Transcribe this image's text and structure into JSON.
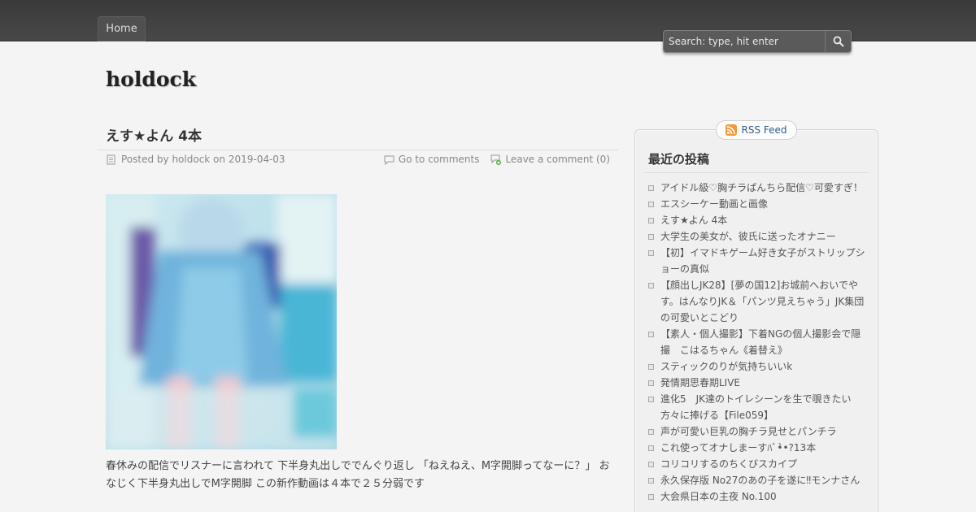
{
  "nav": {
    "home_label": "Home"
  },
  "search": {
    "placeholder": "Search: type, hit enter"
  },
  "site": {
    "title": "holdock"
  },
  "post": {
    "title": "えす★よん 4本",
    "meta_posted": "Posted by holdock on 2019-04-03",
    "go_to_comments": "Go to comments",
    "leave_comment": "Leave a comment (0)",
    "body": "春休みの配信でリスナーに言われて 下半身丸出しででんぐり返し 「ねえねえ、M字開脚ってなーに？」 おなじく下半身丸出しでM字開脚 この新作動画は４本で２５分弱です"
  },
  "sidebar": {
    "rss_label": "RSS Feed",
    "widget_title": "最近の投稿",
    "recent_posts": [
      "アイドル級♡胸チラぱんちら配信♡可愛すぎ！",
      "エスシーケー動画と画像",
      "えす★よん 4本",
      "大学生の美女が、彼氏に送ったオナニー",
      "【初】イマドキゲーム好き女子がストリップショーの真似",
      "【顔出しJK28】[夢の国12]お城前へおいでやす。はんなりJK＆「パンツ見えちゃう」JK集団の可愛いとこどり",
      "【素人・個人撮影】下着NGの個人撮影会で隠撮　こはるちゃん《着替え》",
      "スティックのりが気持ちいいk",
      "発情期思春期LIVE",
      "進化5　JK達のトイレシーンを生で覗きたい方々に捧げる【File059】",
      "声が可愛い巨乳の胸チラ見せとパンチラ",
      "これ使ってオナしまーすﾊﾞ•̀̀•?13本",
      "コリコリするのちくびスカイプ",
      "永久保存版 No27のあの子を遂に‼︎モンナさん",
      "大会県日本の主夜 No.100"
    ]
  },
  "icons": {
    "search": "search-icon",
    "posted": "document-icon",
    "comments": "speech-bubble-icon",
    "leave_comment": "add-comment-icon",
    "rss": "rss-icon"
  },
  "colors": {
    "topbar": "#3f3f3f",
    "link": "#2f5c8a",
    "background": "#f4f4f4"
  }
}
